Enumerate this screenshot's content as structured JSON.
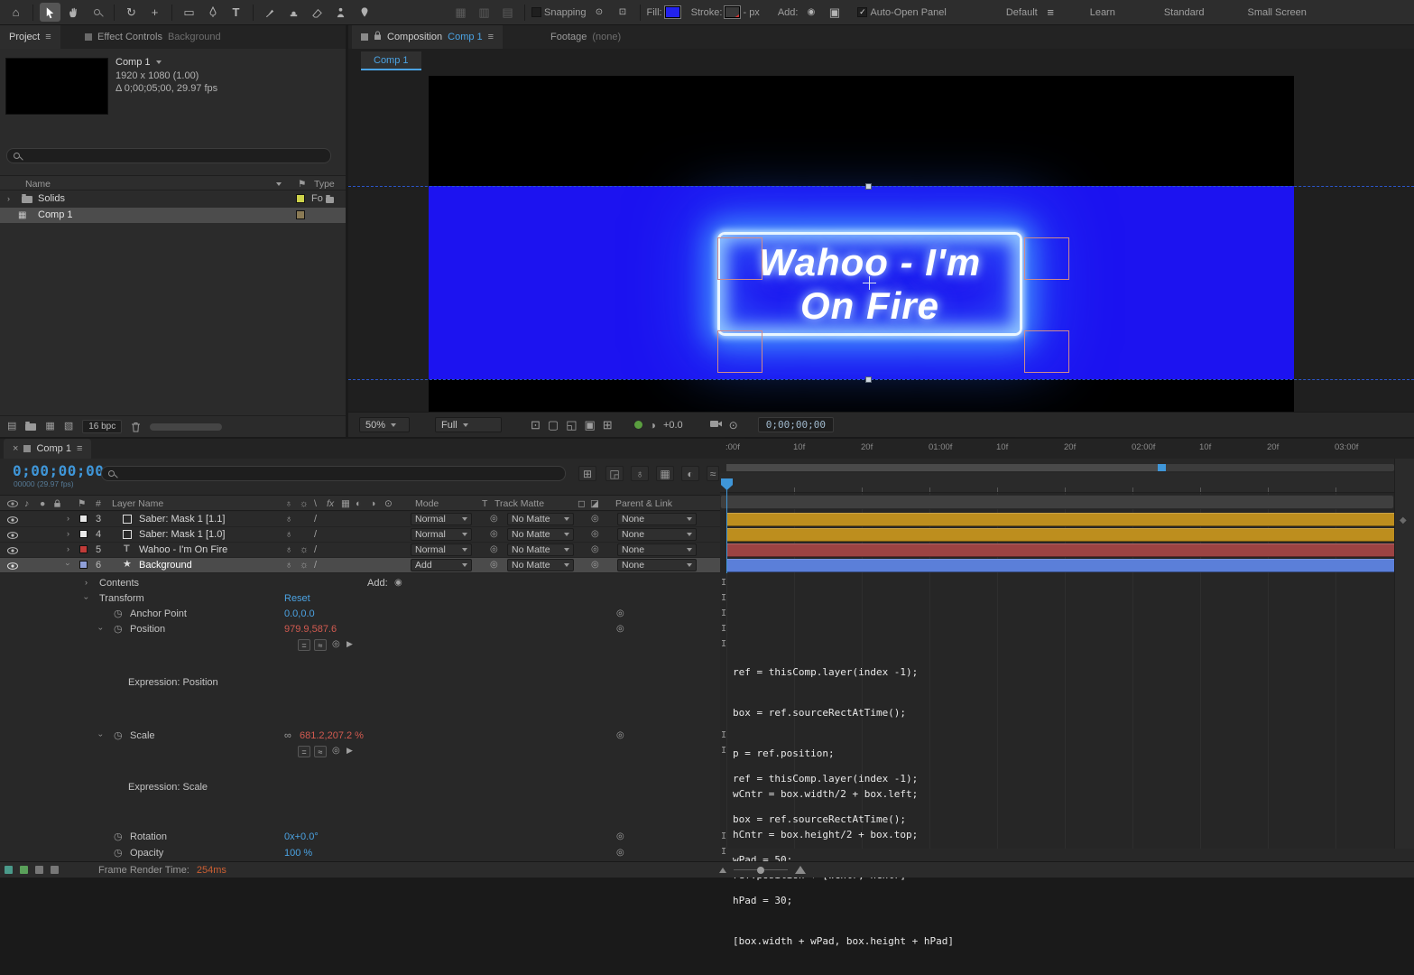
{
  "toolbar": {
    "snapping": "Snapping",
    "fill": "Fill:",
    "stroke": "Stroke:",
    "px": "- px",
    "add": "Add:",
    "auto_open": "Auto-Open Panel",
    "workspace": "Default",
    "learn": "Learn",
    "standard": "Standard",
    "small_screen": "Small Screen"
  },
  "tabs": {
    "project": "Project",
    "effect_controls": "Effect Controls",
    "effect_controls_target": "Background",
    "composition": "Composition",
    "composition_target": "Comp 1",
    "footage": "Footage",
    "footage_target": "(none)"
  },
  "project": {
    "comp_name": "Comp 1",
    "info1": "1920 x 1080 (1.00)",
    "info2": "Δ 0;00;05;00, 29.97 fps",
    "col_name": "Name",
    "col_type": "Type",
    "rows": [
      {
        "name": "Solids",
        "type": "Fo"
      },
      {
        "name": "Comp 1",
        "type": ""
      }
    ],
    "bpc": "16 bpc"
  },
  "viewer": {
    "tab": "Comp 1",
    "title_line1": "Wahoo - I'm",
    "title_line2": "On Fire",
    "zoom": "50%",
    "resolution": "Full",
    "exposure": "+0.0",
    "timecode": "0;00;00;00"
  },
  "timeline": {
    "tab": "Comp 1",
    "timecode": "0;00;00;00",
    "frames_info": "00000 (29.97 fps)",
    "header": {
      "hash": "#",
      "layer_name": "Layer Name",
      "mode": "Mode",
      "t": "T",
      "track_matte": "Track Matte",
      "parent": "Parent & Link"
    },
    "layers": [
      {
        "num": "3",
        "name": "Saber: Mask 1 [1.1]",
        "mode": "Normal",
        "matte": "No Matte",
        "parent": "None",
        "swatch": "#e9e9e9",
        "bar": "#bd8e1e"
      },
      {
        "num": "4",
        "name": "Saber: Mask 1 [1.0]",
        "mode": "Normal",
        "matte": "No Matte",
        "parent": "None",
        "swatch": "#e9e9e9",
        "bar": "#bd8e1e"
      },
      {
        "num": "5",
        "name": "Wahoo - I'm  On Fire",
        "mode": "Normal",
        "matte": "No Matte",
        "parent": "None",
        "swatch": "#c13b38",
        "bar": "#9c4343"
      },
      {
        "num": "6",
        "name": "Background",
        "mode": "Add",
        "matte": "No Matte",
        "parent": "None",
        "swatch": "#8f9fd8",
        "bar": "#5b7fd9"
      }
    ],
    "props": {
      "contents": "Contents",
      "add": "Add:",
      "transform": "Transform",
      "reset": "Reset",
      "anchor_label": "Anchor Point",
      "anchor_value": "0.0,0.0",
      "position_label": "Position",
      "position_value": "979.9,587.6",
      "expr_position_label": "Expression: Position",
      "scale_label": "Scale",
      "scale_value": "681.2,207.2 %",
      "expr_scale_label": "Expression: Scale",
      "rotation_label": "Rotation",
      "rotation_value": "0x+0.0°",
      "opacity_label": "Opacity",
      "opacity_value": "100 %"
    },
    "expr_position": [
      "ref = thisComp.layer(index -1);",
      "box = ref.sourceRectAtTime();",
      "p = ref.position;",
      "wCntr = box.width/2 + box.left;",
      "hCntr = box.height/2 + box.top;",
      "ref.position + [wCntr, hCntr]"
    ],
    "expr_scale": [
      "ref = thisComp.layer(index -1);",
      "box = ref.sourceRectAtTime();",
      "wPad = 50;",
      "hPad = 30;",
      "[box.width + wPad, box.height + hPad]"
    ],
    "ruler": [
      ":00f",
      "10f",
      "20f",
      "01:00f",
      "10f",
      "20f",
      "02:00f",
      "10f",
      "20f",
      "03:00f"
    ]
  },
  "status": {
    "label": "Frame Render Time:",
    "value": "254ms"
  },
  "colors": {
    "accent": "#3f96d8",
    "expression_value": "#d25a50",
    "comp_blue": "#1c13f0"
  }
}
